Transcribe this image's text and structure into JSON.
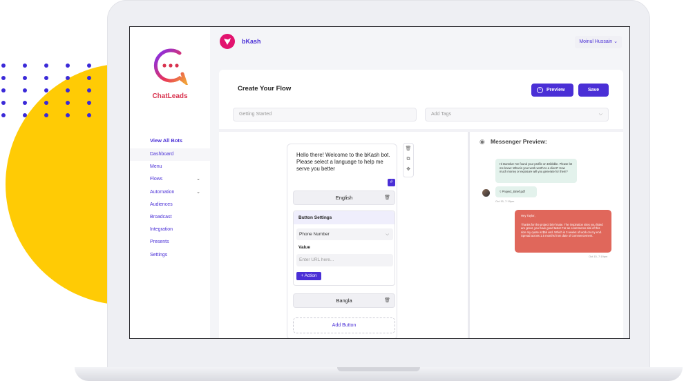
{
  "brand": {
    "name": "ChatLeads"
  },
  "sidebar": {
    "view_all": "View All Bots",
    "items": [
      {
        "label": "Dashboard",
        "active": true,
        "expandable": false
      },
      {
        "label": "Menu",
        "expandable": false
      },
      {
        "label": "Flows",
        "expandable": true
      },
      {
        "label": "Automation",
        "expandable": true
      },
      {
        "label": "Audiences",
        "expandable": false
      },
      {
        "label": "Broadcast",
        "expandable": false
      },
      {
        "label": "Integration",
        "expandable": false
      },
      {
        "label": "Presents",
        "expandable": false
      },
      {
        "label": "Settings",
        "expandable": false
      }
    ]
  },
  "header": {
    "bot_name": "bKash",
    "user_name": "Moinul Hussain",
    "user_chevron": "⌄"
  },
  "main": {
    "title": "Create Your Flow",
    "preview_label": "Preview",
    "save_label": "Save",
    "getting_started_placeholder": "Getting Started",
    "tags_placeholder": "Add Tags"
  },
  "node": {
    "message": "Hello there! Welcome to the bKash bot. Please select a language to help me serve you better",
    "hash": "#",
    "buttons": [
      "English",
      "Bangla"
    ],
    "settings": {
      "title": "Button Settings",
      "type": "Phone Number",
      "value_label": "Value",
      "value_placeholder": "Enter URL here...",
      "action_label": "+ Action"
    },
    "add_button": "Add Button"
  },
  "preview": {
    "title": "Messenger Preview:",
    "incoming_message": "Hi Dannka! I've found your profile on Dribbble. Please let me know: What is your work worth to a client? How much money or exposure will you generate for them?",
    "file_name": "Project_Brief.pdf",
    "time_in": "Oct 15, 7:19pm",
    "outgoing_greeting": "Hey Taylor,",
    "outgoing_message": "Thanks for the project brief mate. The inspiration sites you listed are great, you have good taste! For an ecommerce site of this size my quote is $5k usd. Which is 3 weeks of work on my end. Spread across 1.5 months from date of commencement.",
    "time_out": "Oct 15, 7:19pm"
  },
  "colors": {
    "accent": "#4A2FD6",
    "brand_red": "#D8324E",
    "bkash_pink": "#E2136E",
    "outgoing_bubble": "#E0675B",
    "incoming_bubble": "#E3F2EC",
    "bg_circle": "#FFCB05"
  }
}
